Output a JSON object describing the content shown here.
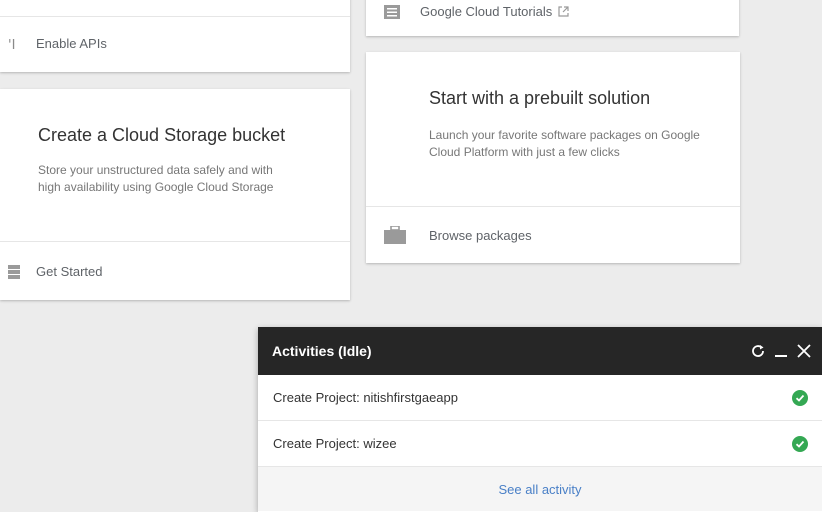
{
  "left_cards": {
    "apis": {
      "link_label": "Enable APIs",
      "icon": "api-icon"
    },
    "storage": {
      "title": "Create a Cloud Storage bucket",
      "description": "Store your unstructured data safely and with high availability using Google Cloud Storage",
      "link_label": "Get Started",
      "icon": "storage-icon"
    }
  },
  "right_cards": {
    "tutorials": {
      "link_label": "Google Cloud Tutorials",
      "icon": "book-icon",
      "external_icon": "external-link-icon"
    },
    "prebuilt": {
      "title": "Start with a prebuilt solution",
      "description": "Launch your favorite software packages on Google Cloud Platform with just a few clicks",
      "link_label": "Browse packages",
      "icon": "briefcase-icon"
    }
  },
  "activities": {
    "title": "Activities (Idle)",
    "controls": [
      "refresh-icon",
      "minimize-icon",
      "close-icon"
    ],
    "items": [
      {
        "label": "Create Project: nitishfirstgaeapp",
        "status": "success"
      },
      {
        "label": "Create Project: wizee",
        "status": "success"
      }
    ],
    "footer_link": "See all activity"
  },
  "colors": {
    "background": "#ececec",
    "panel_header": "#262626",
    "success": "#34a853",
    "link": "#4a80c7"
  }
}
